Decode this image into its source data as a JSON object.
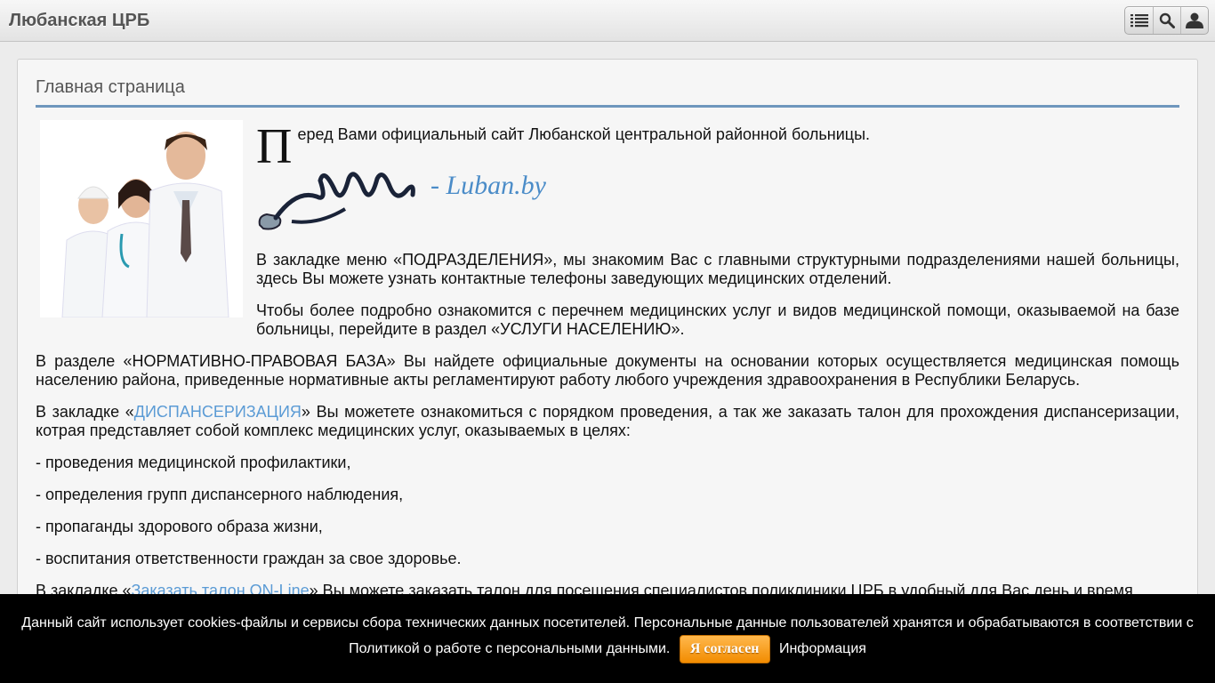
{
  "header": {
    "site_title": "Любанская ЦРБ",
    "icons": [
      "menu-list-icon",
      "search-icon",
      "user-icon"
    ]
  },
  "page": {
    "title": "Главная страница",
    "dropcap": "П",
    "intro_rest": "еред Вами официальный сайт Любанской центральной районной больницы.",
    "logo_text": "- Luban.by",
    "paragraphs": {
      "p1": "В закладке меню «ПОДРАЗДЕЛЕНИЯ», мы знакомим Вас с главными структурными подразделениями нашей больницы, здесь Вы можете узнать контактные телефоны заведующих медицинских отделений.",
      "p2": "Чтобы более подробно ознакомится с перечнем медицинских услуг и видов медицинской помощи, оказываемой на базе больницы, перейдите в раздел «УСЛУГИ НАСЕЛЕНИЮ».",
      "p3": "В разделе «НОРМАТИВНО-ПРАВОВАЯ БАЗА» Вы найдете официальные документы на основании которых осуществляется медицинская помощь населению района, приведенные нормативные акты регламентируют работу любого учреждения здравоохранения в Республики Беларусь.",
      "p4_before": "В закладке «",
      "p4_link": "ДИСПАНСЕРИЗАЦИЯ",
      "p4_after": "» Вы можетете ознакомиться с порядком проведения, а так же заказать талон для прохождения диспансеризации, котрая представляет собой комплекс медицинских услуг, оказываемых в целях:",
      "l1": "- проведения медицинской профилактики,",
      "l2": "- определения групп диспансерного наблюдения,",
      "l3": "- пропаганды здорового образа жизни,",
      "l4": "- воспитания ответственности граждан за свое здоровье.",
      "p5_before": "В закладке «",
      "p5_link": "Заказать талон ON-Line",
      "p5_after": "» Вы можете заказать талон для посещения специалистов поликлиники ЦРБ в удобный для Вас день и время"
    }
  },
  "cookie": {
    "text": "Данный сайт использует cookies-файлы и сервисы сбора технических данных посетителей. Персональные данные пользователей хранятся и обрабатываются в соответствии с Политикой о работе с персональными данными.",
    "agree_label": "Я согласен",
    "info_label": "Информация"
  },
  "colors": {
    "accent_rule": "#6f97bd",
    "link": "#5b9bd5",
    "button_orange": "#f28c00"
  }
}
